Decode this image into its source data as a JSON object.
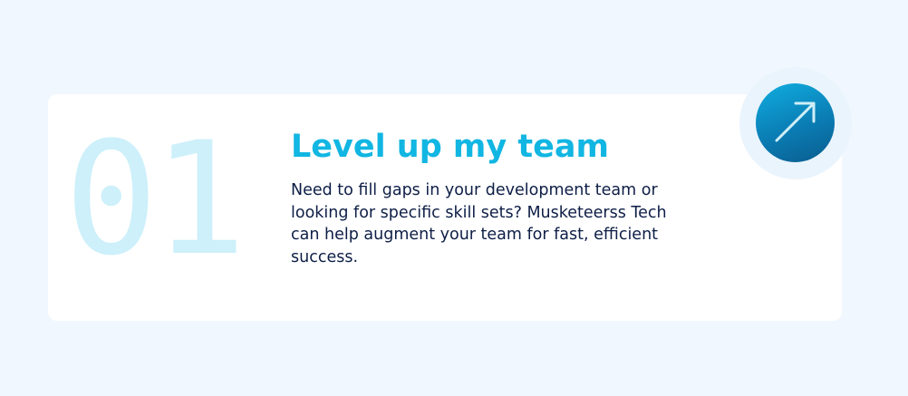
{
  "card": {
    "number": "01",
    "title": "Level up my team",
    "description": "Need to fill gaps in your development team or looking for specific skill sets? Musketeerss Tech can help augment your team for fast, efficient success.",
    "action_icon": "arrow-up-right-icon"
  },
  "colors": {
    "page_background": "#f1f7fe",
    "card_background": "#ffffff",
    "number": "#cdf0fa",
    "title": "#11b6e2",
    "description": "#0d1e46",
    "button_start": "#10aee0",
    "button_end": "#0a5c8e"
  }
}
